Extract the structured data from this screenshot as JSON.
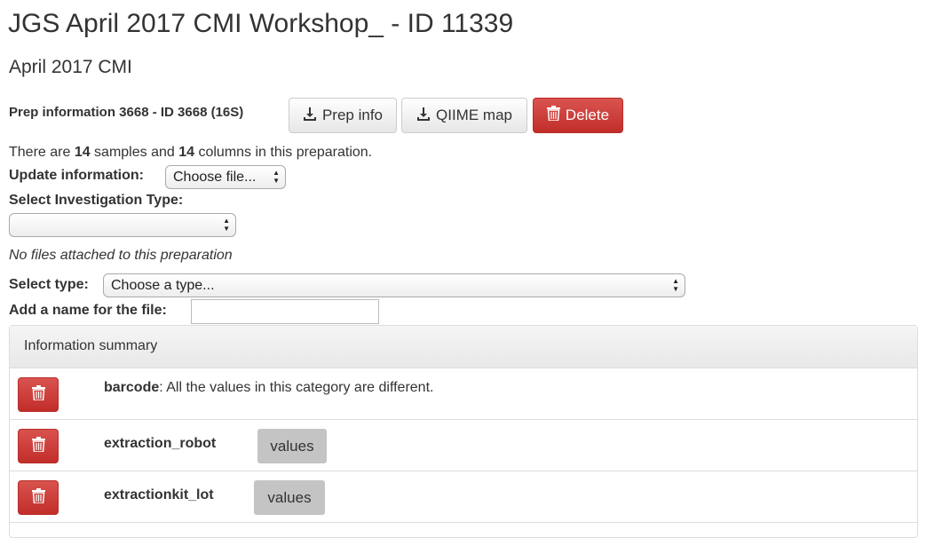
{
  "page": {
    "title": "JGS April 2017 CMI Workshop_ - ID 11339",
    "subtitle": "April 2017 CMI"
  },
  "prep": {
    "label": "Prep information 3668 - ID 3668 (16S)",
    "buttons": {
      "prep_info": "Prep info",
      "qiime_map": "QIIME map",
      "delete": "Delete"
    }
  },
  "summary_text": {
    "prefix": "There are ",
    "samples": "14",
    "middle": " samples and ",
    "columns": "14",
    "suffix": " columns in this preparation."
  },
  "update": {
    "label": "Update information:",
    "file_button": "Choose file..."
  },
  "investigation": {
    "label": "Select Investigation Type:",
    "selected": ""
  },
  "no_files_text": "No files attached to this preparation",
  "select_type": {
    "label": "Select type:",
    "selected": "Choose a type..."
  },
  "file_name": {
    "label": "Add a name for the file:",
    "value": ""
  },
  "info_panel": {
    "heading": "Information summary",
    "rows": [
      {
        "name": "barcode",
        "description": ": All the values in this category are different."
      },
      {
        "name": "extraction_robot",
        "values_label": "values"
      },
      {
        "name": "extractionkit_lot",
        "values_label": "values"
      }
    ]
  },
  "icons": {
    "download": "download-icon",
    "trash": "trash-icon",
    "select_arrows": "select-arrows-icon"
  },
  "colors": {
    "danger": "#d9534f",
    "text": "#333333"
  }
}
